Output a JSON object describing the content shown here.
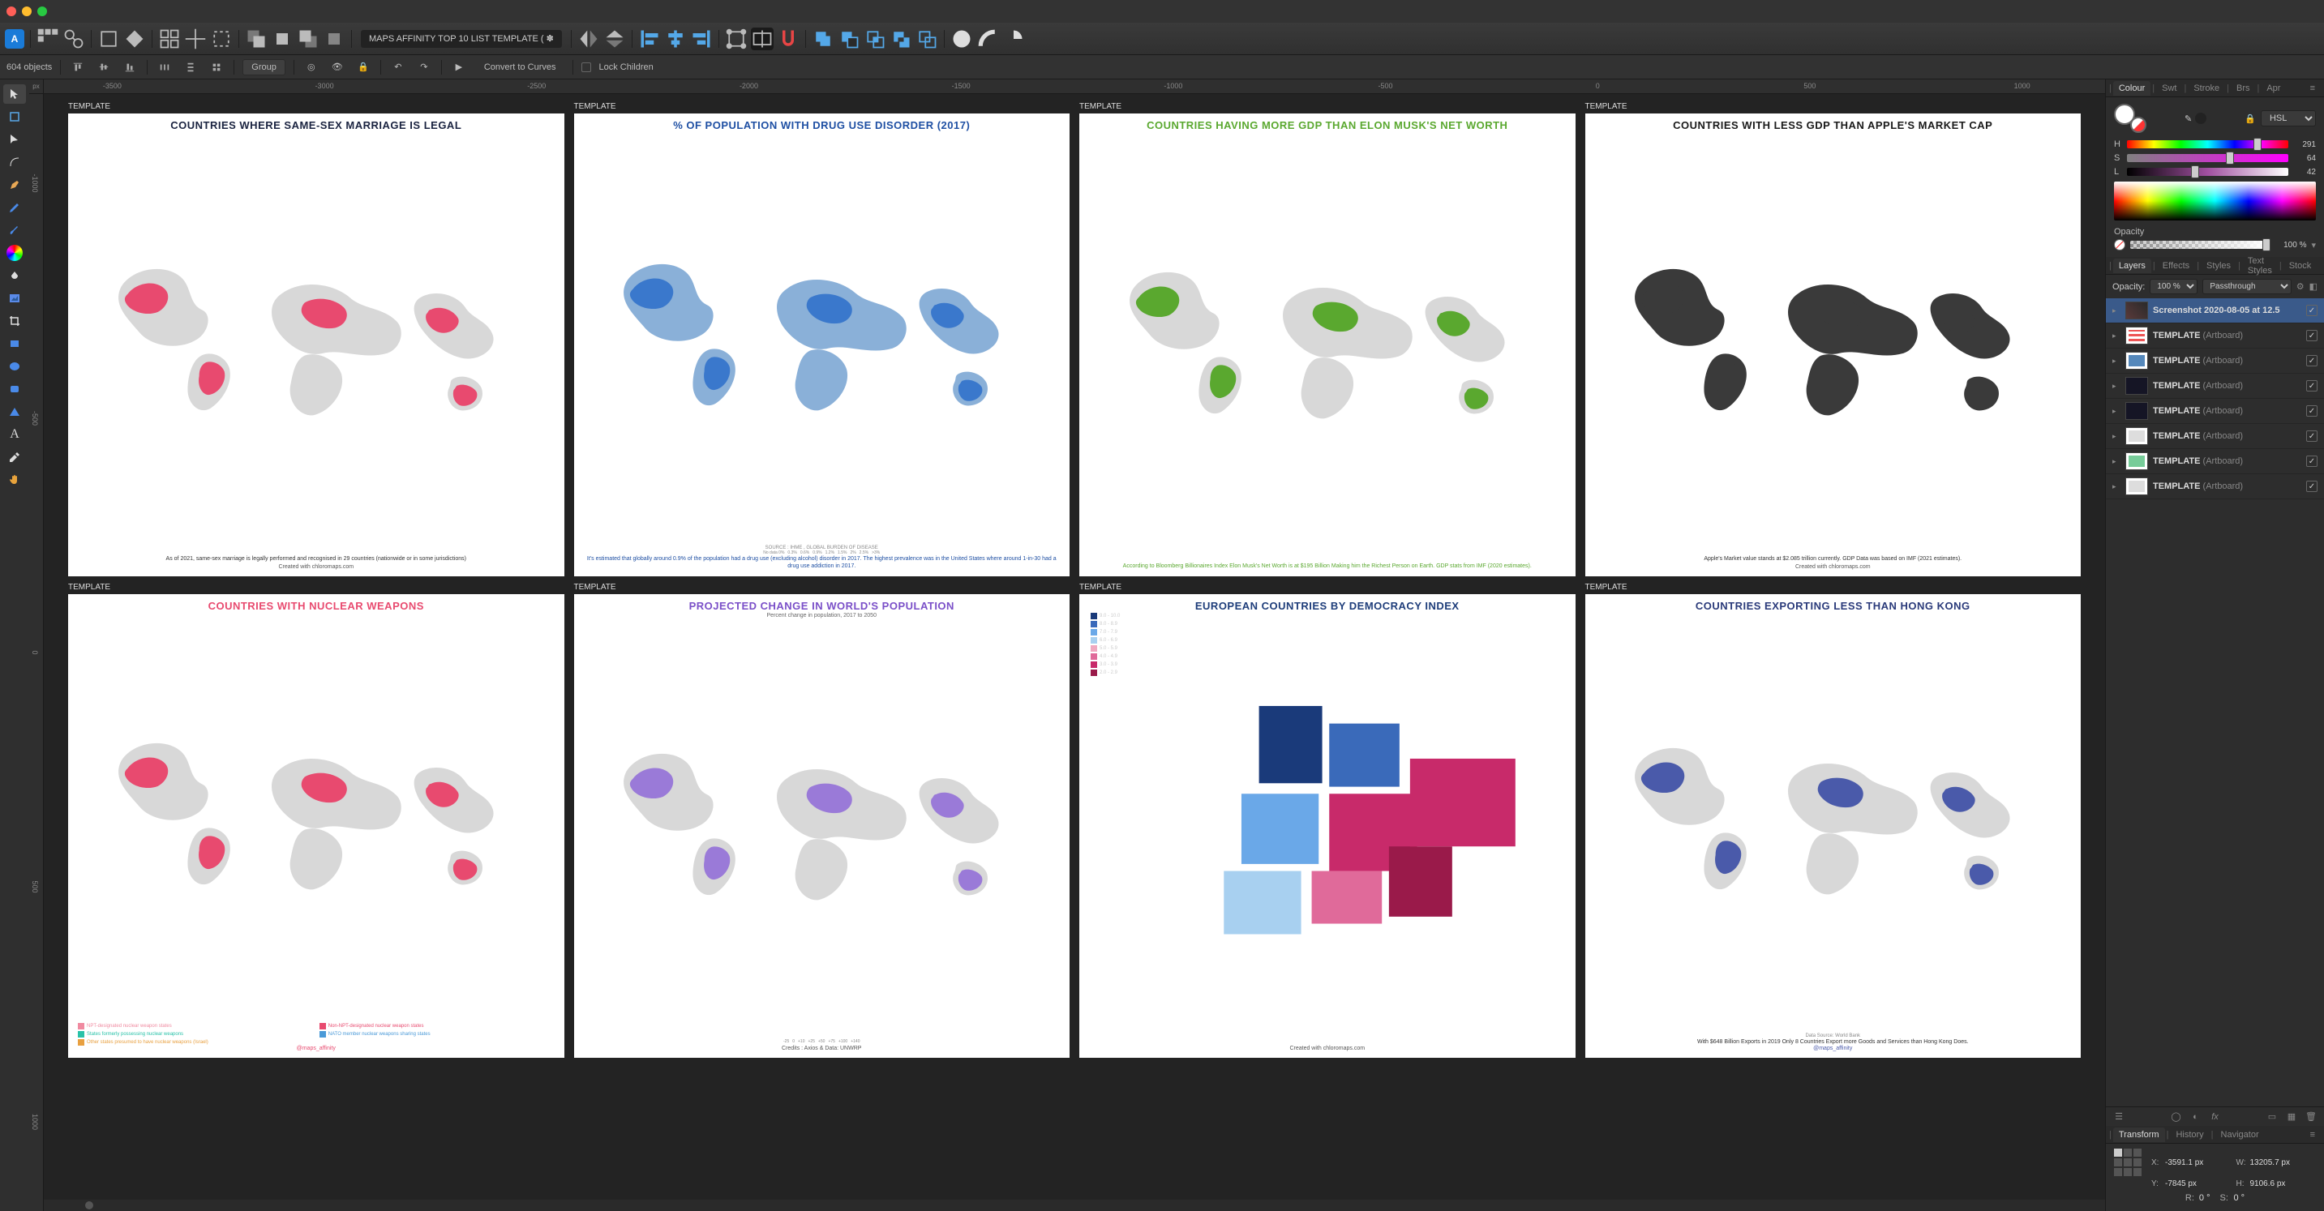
{
  "app": {
    "name": "Affinity Designer"
  },
  "document_title": "MAPS AFFINITY TOP 10 LIST TEMPLATE (",
  "document_modified_indicator": "✽",
  "context_toolbar": {
    "object_count": "604 objects",
    "group_btn": "Group",
    "convert_btn": "Convert to Curves",
    "lock_children": "Lock Children"
  },
  "ruler": {
    "unit": "px",
    "h_ticks": [
      "-3500",
      "-3000",
      "-2500",
      "-2000",
      "-1500",
      "-1000",
      "-500",
      "0",
      "500",
      "1000"
    ],
    "v_ticks": [
      "-1000",
      "-500",
      "0",
      "500",
      "1000"
    ]
  },
  "artboards_label": "TEMPLATE",
  "artboards": [
    {
      "title": "COUNTRIES WHERE SAME-SEX MARRIAGE IS LEGAL",
      "color": "#1a2340",
      "accent": "#e84a6f",
      "body": "As of 2021, same-sex marriage is legally performed and recognised in 29 countries (nationwide or in some jurisdictions)",
      "footer": "Created with chloromaps.com"
    },
    {
      "title": "% OF POPULATION WITH DRUG USE DISORDER (2017)",
      "color": "#1e4fa3",
      "accent": "#3a78cc",
      "body": "It's estimated that globally around 0.9% of the population had a drug use (excluding alcohol) disorder in 2017. The highest prevalence was in the United States where around 1-in-30 had a drug use addiction in 2017.",
      "footer": "",
      "source": "SOURCE : IHME , GLOBAL BURDEN OF DISEASE",
      "scale": [
        "No data 0%",
        "0.3%",
        "0.6%",
        "0.9%",
        "1.2%",
        "1.5%",
        "2%",
        "2.5%",
        ">3%"
      ]
    },
    {
      "title": "COUNTRIES HAVING MORE GDP THAN ELON MUSK'S NET WORTH",
      "color": "#5aa82f",
      "accent": "#5aa82f",
      "body": "According to Bloomberg Billionaires Index Elon Musk's Net Worth is at $195 Billion Making him the Richest Person on Earth. GDP stats from IMF (2020 estimates).",
      "footer": ""
    },
    {
      "title": "COUNTRIES WITH LESS GDP THAN APPLE'S MARKET CAP",
      "color": "#1a1a1a",
      "accent": "#3a3a3a",
      "body": "Apple's Market value stands at $2.085 trillion currently. GDP Data was based on IMF (2021 estimates).",
      "footer": "Created with chloromaps.com"
    },
    {
      "title": "COUNTRIES WITH NUCLEAR WEAPONS",
      "color": "#e84a6f",
      "accent": "#e84a6f",
      "body": "",
      "footer": "",
      "legend": [
        {
          "c": "#f08aa0",
          "t": "NPT-designated nuclear weapon states"
        },
        {
          "c": "#e84a6f",
          "t": "Non-NPT-designated nuclear weapon states"
        },
        {
          "c": "#28c2a8",
          "t": "States formerly possessing nuclear weapons"
        },
        {
          "c": "#4a9ad8",
          "t": "NATO member nuclear weapons sharing states"
        },
        {
          "c": "#e8a040",
          "t": "Other states presumed to have nuclear weapons (Israel)"
        }
      ],
      "tag": "@maps_affinity"
    },
    {
      "title": "PROJECTED CHANGE IN WORLD'S POPULATION",
      "color": "#7a4fc8",
      "accent": "#9a7ad8",
      "body": "",
      "footer": "Credits : Axios & Data: UNWRP",
      "subtitle": "Percent change in population, 2017 to 2050",
      "scale": [
        "-25",
        "0",
        "+10",
        "+25",
        "+50",
        "+75",
        "+100",
        "+140"
      ]
    },
    {
      "title": "EUROPEAN COUNTRIES BY DEMOCRACY INDEX",
      "color": "#1e3d7a",
      "accent": "#4a8ad8",
      "body": "",
      "footer": "Created with chloromaps.com",
      "legend": [
        {
          "c": "#1a3a7a",
          "t": "9.0 - 10.0"
        },
        {
          "c": "#3a6aba",
          "t": "8.0 - 8.9"
        },
        {
          "c": "#6aa8e8",
          "t": "7.0 - 7.9"
        },
        {
          "c": "#a8d0f0",
          "t": "6.0 - 6.9"
        },
        {
          "c": "#f0a8c0",
          "t": "5.0 - 5.9"
        },
        {
          "c": "#e06a9a",
          "t": "4.0 - 4.9"
        },
        {
          "c": "#c82a6a",
          "t": "3.0 - 3.9"
        },
        {
          "c": "#9a1a4a",
          "t": "2.0 - 2.9"
        }
      ]
    },
    {
      "title": "COUNTRIES EXPORTING LESS THAN HONG KONG",
      "color": "#2a3a7a",
      "accent": "#4a5aaa",
      "body": "With $648 Billion Exports in 2019 Only 8 Countries Export more Goods and Services than Hong Kong Does.",
      "footer": "",
      "source": "Data Source: World Bank",
      "tag": "@maps_affinity"
    }
  ],
  "panels": {
    "colour_tab": "Colour",
    "swatches_tab": "Swt",
    "stroke_tab": "Stroke",
    "brushes_tab": "Brs",
    "appearance_tab": "Apr",
    "colour": {
      "mode": "HSL",
      "h_label": "H",
      "h_val": "291",
      "s_label": "S",
      "s_val": "64",
      "l_label": "L",
      "l_val": "42",
      "opacity_label": "Opacity",
      "opacity_val": "100 %"
    },
    "layers_tab": "Layers",
    "effects_tab": "Effects",
    "styles_tab": "Styles",
    "textstyles_tab": "Text Styles",
    "stock_tab": "Stock",
    "layers": {
      "opacity_label": "Opacity:",
      "opacity_val": "100 %",
      "blend_mode": "Passthrough",
      "items": [
        {
          "name": "Screenshot 2020-08-05 at 12.5",
          "type": "",
          "thumb": "th-screenshot",
          "selected": true
        },
        {
          "name": "TEMPLATE",
          "type": "(Artboard)",
          "thumb": "th1"
        },
        {
          "name": "TEMPLATE",
          "type": "(Artboard)",
          "thumb": "th2"
        },
        {
          "name": "TEMPLATE",
          "type": "(Artboard)",
          "thumb": "th3"
        },
        {
          "name": "TEMPLATE",
          "type": "(Artboard)",
          "thumb": "th4"
        },
        {
          "name": "TEMPLATE",
          "type": "(Artboard)",
          "thumb": "th5"
        },
        {
          "name": "TEMPLATE",
          "type": "(Artboard)",
          "thumb": "th6"
        },
        {
          "name": "TEMPLATE",
          "type": "(Artboard)",
          "thumb": "th5"
        }
      ]
    },
    "transform_tab": "Transform",
    "history_tab": "History",
    "navigator_tab": "Navigator",
    "transform": {
      "x_label": "X:",
      "x_val": "-3591.1 px",
      "y_label": "Y:",
      "y_val": "-7845 px",
      "w_label": "W:",
      "w_val": "13205.7 px",
      "h_label": "H:",
      "h_val": "9106.6 px",
      "r_label": "R:",
      "r_val": "0 °",
      "s_label": "S:",
      "s_val": "0 °"
    }
  }
}
